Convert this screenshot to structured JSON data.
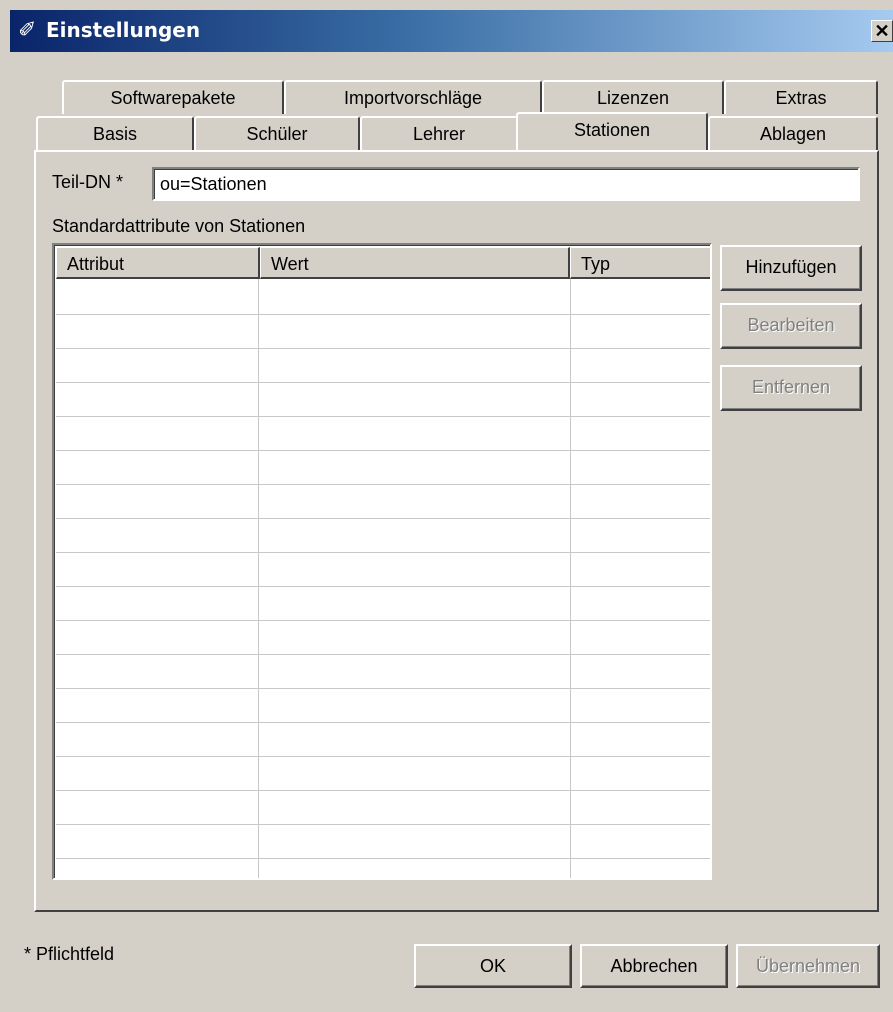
{
  "window": {
    "title": "Einstellungen",
    "close_glyph": "✕",
    "icon": "gear-pencil-icon"
  },
  "tabs": {
    "row1": [
      "Softwarepakete",
      "Importvorschläge",
      "Lizenzen",
      "Extras"
    ],
    "row2": [
      "Basis",
      "Schüler",
      "Lehrer",
      "Stationen",
      "Ablagen"
    ],
    "active": "Stationen"
  },
  "form": {
    "teil_dn_label": "Teil-DN *",
    "teil_dn_value": "ou=Stationen",
    "section_label": "Standardattribute von Stationen"
  },
  "table": {
    "columns": [
      "Attribut",
      "Wert",
      "Typ"
    ],
    "rows": []
  },
  "side_buttons": {
    "add": "Hinzufügen",
    "edit": "Bearbeiten",
    "remove": "Entfernen"
  },
  "footer": {
    "note": "* Pflichtfeld",
    "ok": "OK",
    "cancel": "Abbrechen",
    "apply": "Übernehmen"
  }
}
